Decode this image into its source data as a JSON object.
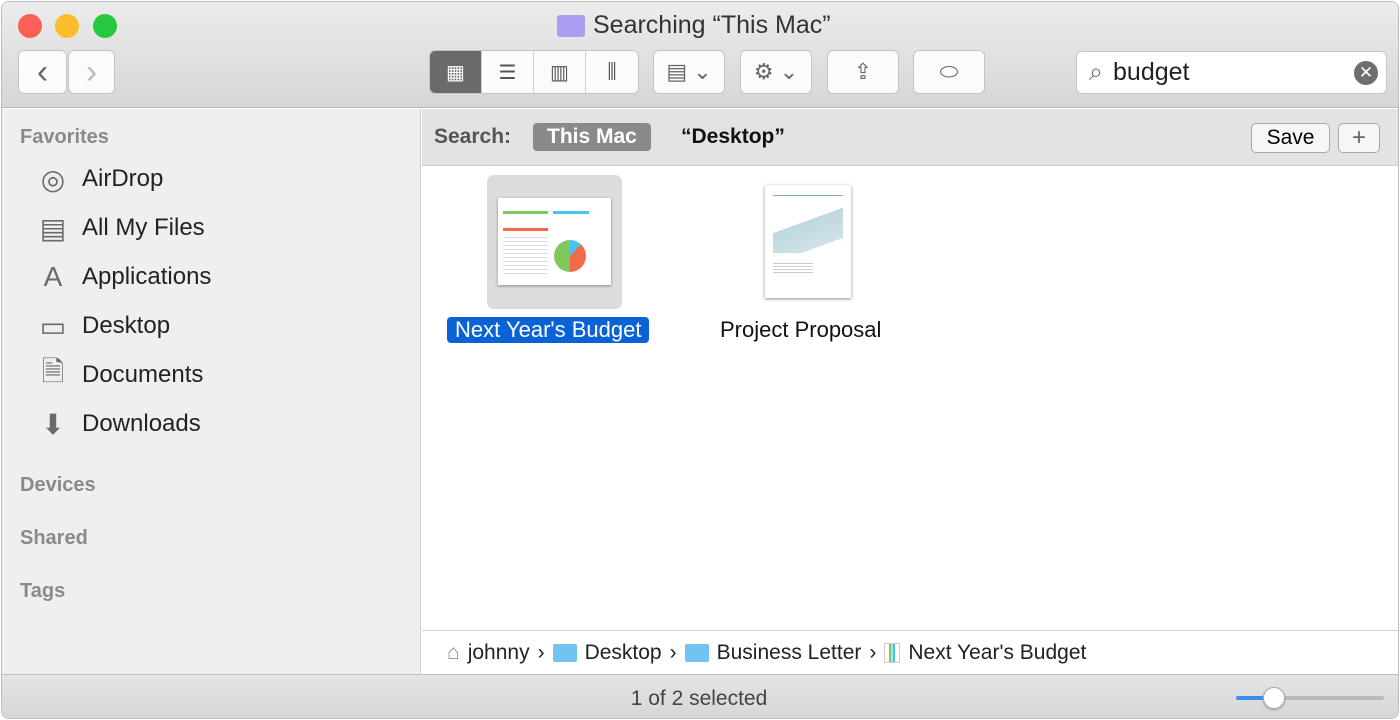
{
  "window": {
    "title": "Searching “This Mac”"
  },
  "toolbar": {
    "back": "‹",
    "forward": "›",
    "search_value": "budget",
    "views": [
      "icon",
      "list",
      "column",
      "cover-flow"
    ]
  },
  "sidebar": {
    "favorites_label": "Favorites",
    "items": [
      {
        "label": "AirDrop",
        "icon": "airdrop-icon"
      },
      {
        "label": "All My Files",
        "icon": "all-files-icon"
      },
      {
        "label": "Applications",
        "icon": "applications-icon"
      },
      {
        "label": "Desktop",
        "icon": "desktop-icon"
      },
      {
        "label": "Documents",
        "icon": "documents-icon"
      },
      {
        "label": "Downloads",
        "icon": "downloads-icon"
      }
    ],
    "devices_label": "Devices",
    "shared_label": "Shared",
    "tags_label": "Tags"
  },
  "search_bar": {
    "label": "Search:",
    "scope_this_mac": "This Mac",
    "scope_desktop": "“Desktop”",
    "save": "Save",
    "add": "+"
  },
  "files": [
    {
      "name": "Next Year's Budget",
      "selected": true
    },
    {
      "name": "Project Proposal",
      "selected": false
    }
  ],
  "path": [
    "johnny",
    "Desktop",
    "Business Letter",
    "Next Year's Budget"
  ],
  "status": {
    "text": "1 of 2 selected",
    "icon_size": 0.25
  },
  "colors": {
    "selection": "#0a63d6",
    "close": "#fc5f57",
    "minimize": "#fdbc2e",
    "zoom": "#28c840"
  }
}
